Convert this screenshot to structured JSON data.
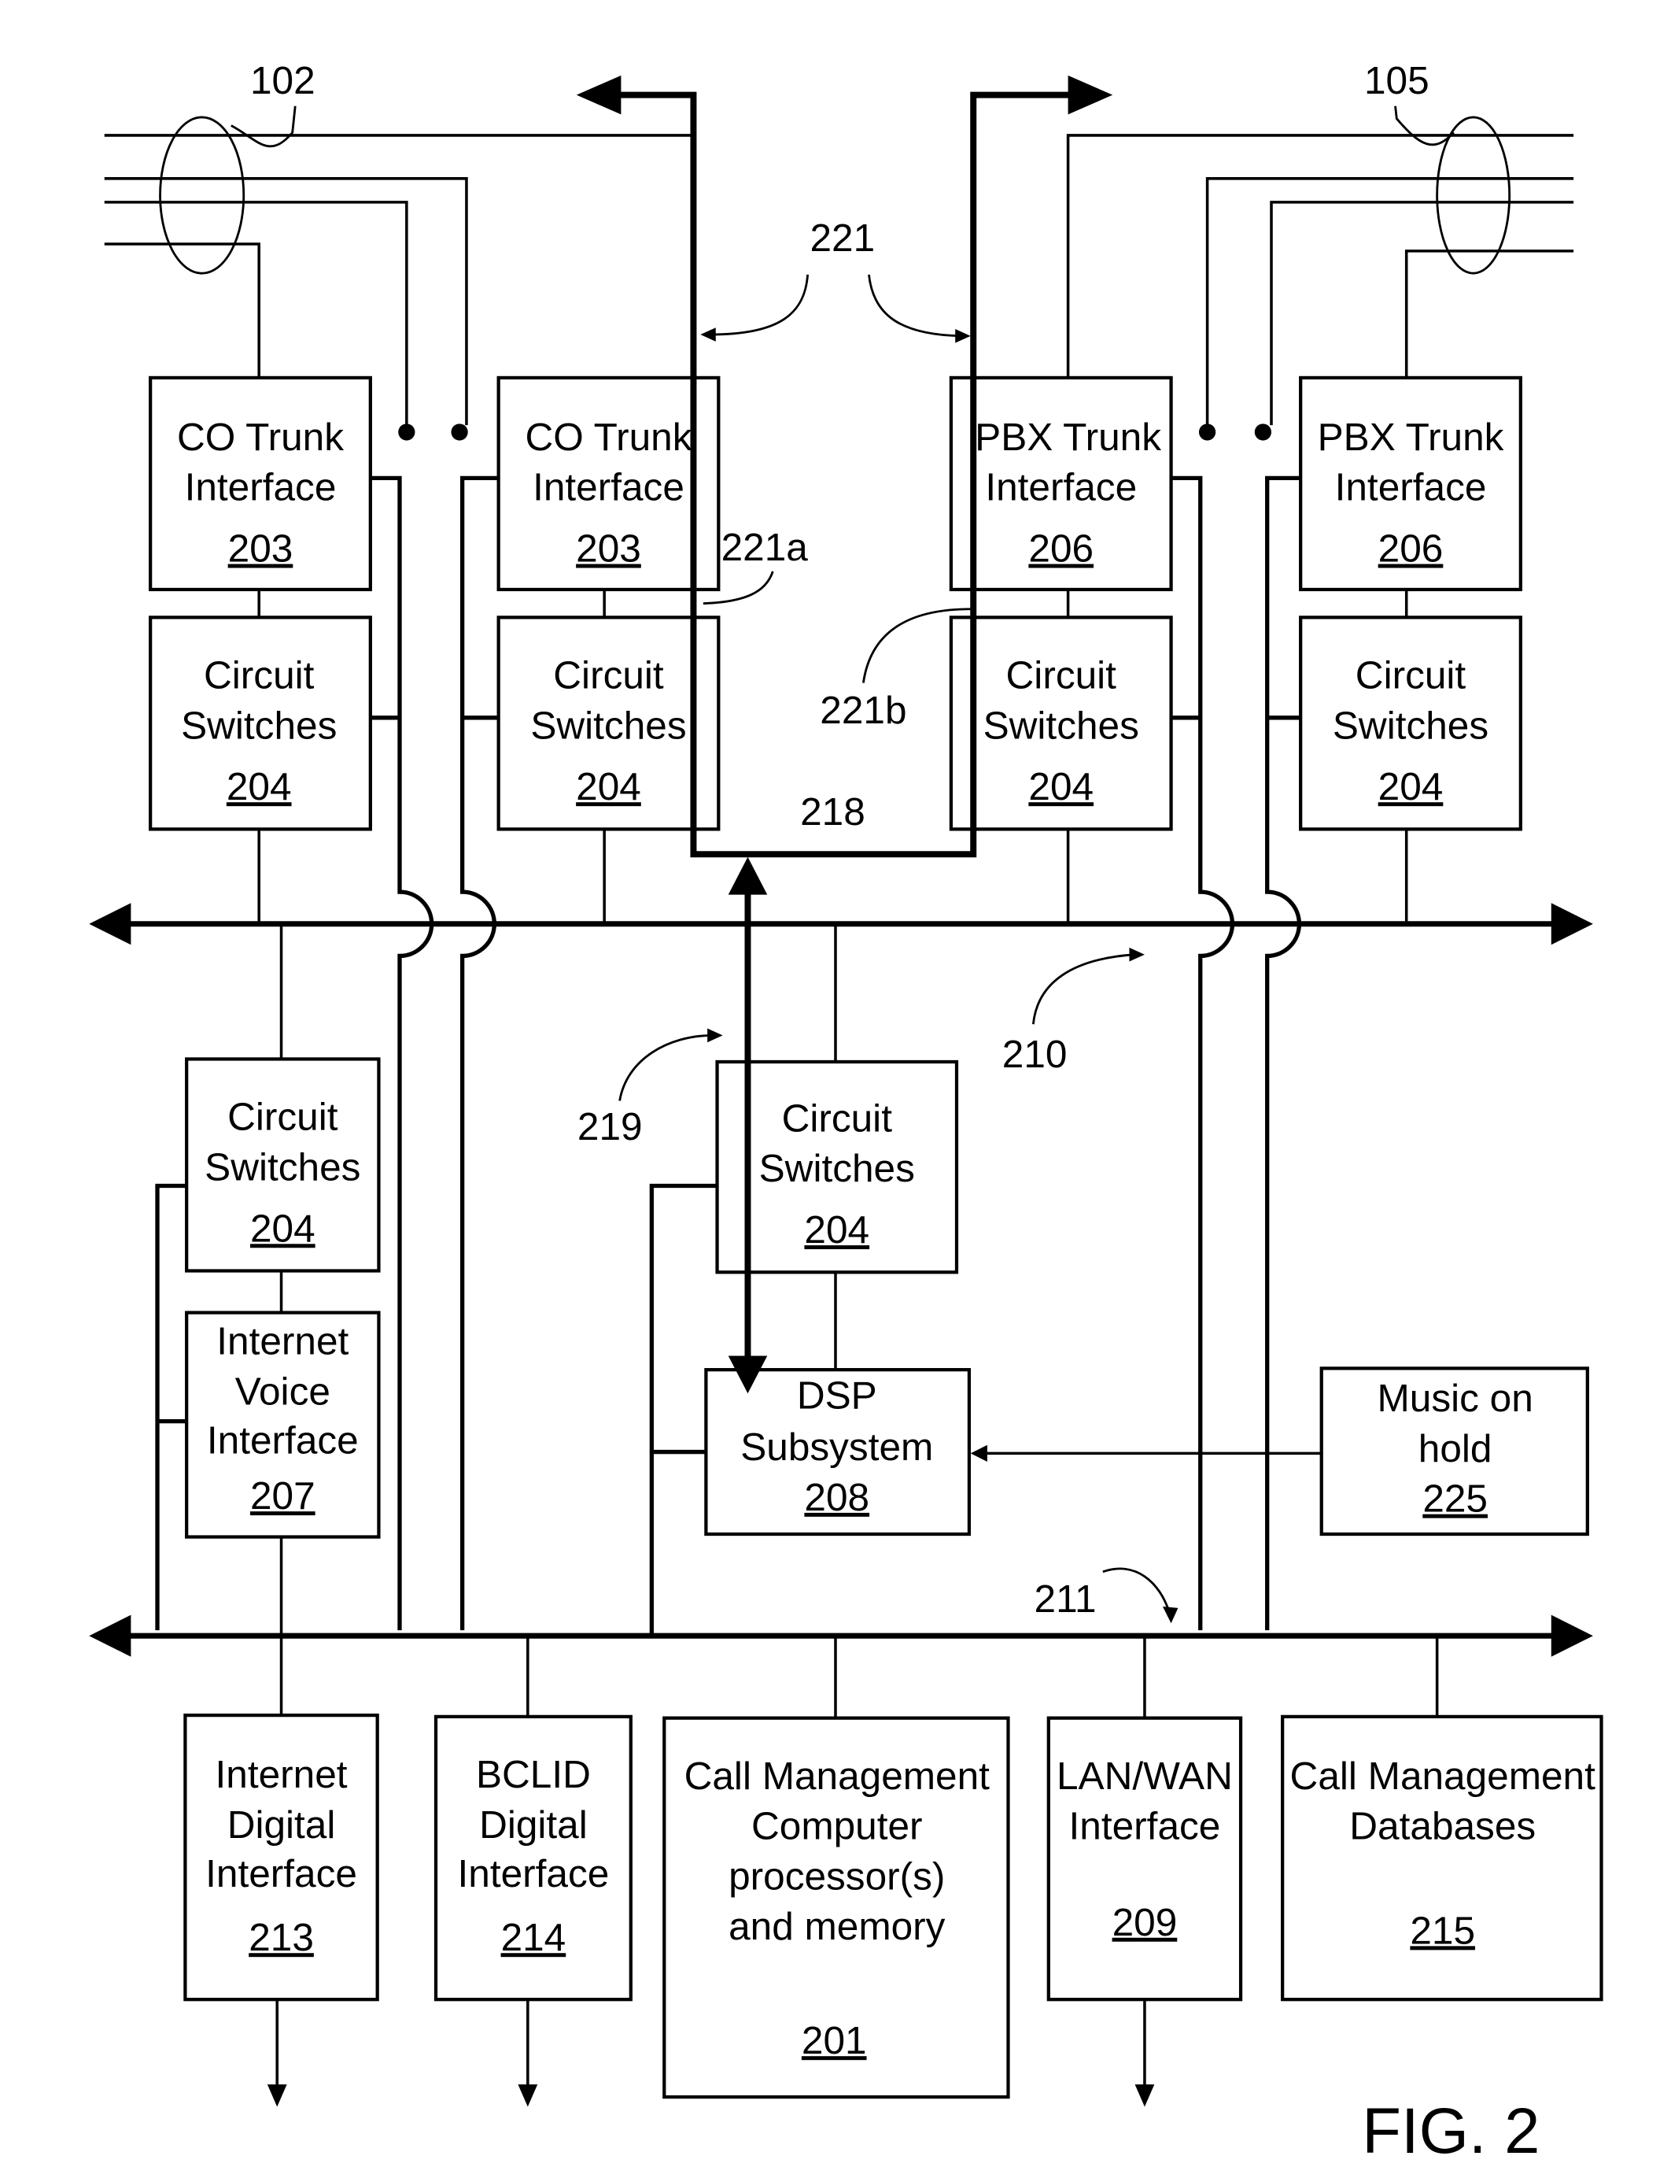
{
  "figure_label": "FIG. 2",
  "blocks": {
    "co_trunk_1": {
      "lines": [
        "CO Trunk",
        "Interface"
      ],
      "ref": "203"
    },
    "co_trunk_2": {
      "lines": [
        "CO Trunk",
        "Interface"
      ],
      "ref": "203"
    },
    "pbx_trunk_1": {
      "lines": [
        "PBX Trunk",
        "Interface"
      ],
      "ref": "206"
    },
    "pbx_trunk_2": {
      "lines": [
        "PBX Trunk",
        "Interface"
      ],
      "ref": "206"
    },
    "cs_top_1": {
      "lines": [
        "Circuit",
        "Switches"
      ],
      "ref": "204"
    },
    "cs_top_2": {
      "lines": [
        "Circuit",
        "Switches"
      ],
      "ref": "204"
    },
    "cs_top_3": {
      "lines": [
        "Circuit",
        "Switches"
      ],
      "ref": "204"
    },
    "cs_top_4": {
      "lines": [
        "Circuit",
        "Switches"
      ],
      "ref": "204"
    },
    "cs_mid_left": {
      "lines": [
        "Circuit",
        "Switches"
      ],
      "ref": "204"
    },
    "cs_mid_center": {
      "lines": [
        "Circuit",
        "Switches"
      ],
      "ref": "204"
    },
    "internet_voice": {
      "lines": [
        "Internet",
        "Voice",
        "Interface"
      ],
      "ref": "207"
    },
    "dsp": {
      "lines": [
        "DSP",
        "Subsystem"
      ],
      "ref": "208"
    },
    "music_on_hold": {
      "lines": [
        "Music on",
        "hold"
      ],
      "ref": "225"
    },
    "internet_digital": {
      "lines": [
        "Internet",
        "Digital",
        "Interface"
      ],
      "ref": "213"
    },
    "bclid_digital": {
      "lines": [
        "BCLID",
        "Digital",
        "Interface"
      ],
      "ref": "214"
    },
    "call_mgmt_computer": {
      "lines": [
        "Call Management",
        "Computer",
        "processor(s)",
        "and memory"
      ],
      "ref": "201"
    },
    "lan_wan": {
      "lines": [
        "LAN/WAN",
        "Interface"
      ],
      "ref": "209"
    },
    "call_mgmt_db": {
      "lines": [
        "Call Management",
        "Databases"
      ],
      "ref": "215"
    }
  },
  "callouts": {
    "c102": "102",
    "c105": "105",
    "c221": "221",
    "c221a": "221a",
    "c221b": "221b",
    "c218": "218",
    "c219": "219",
    "c210": "210",
    "c211": "211"
  }
}
